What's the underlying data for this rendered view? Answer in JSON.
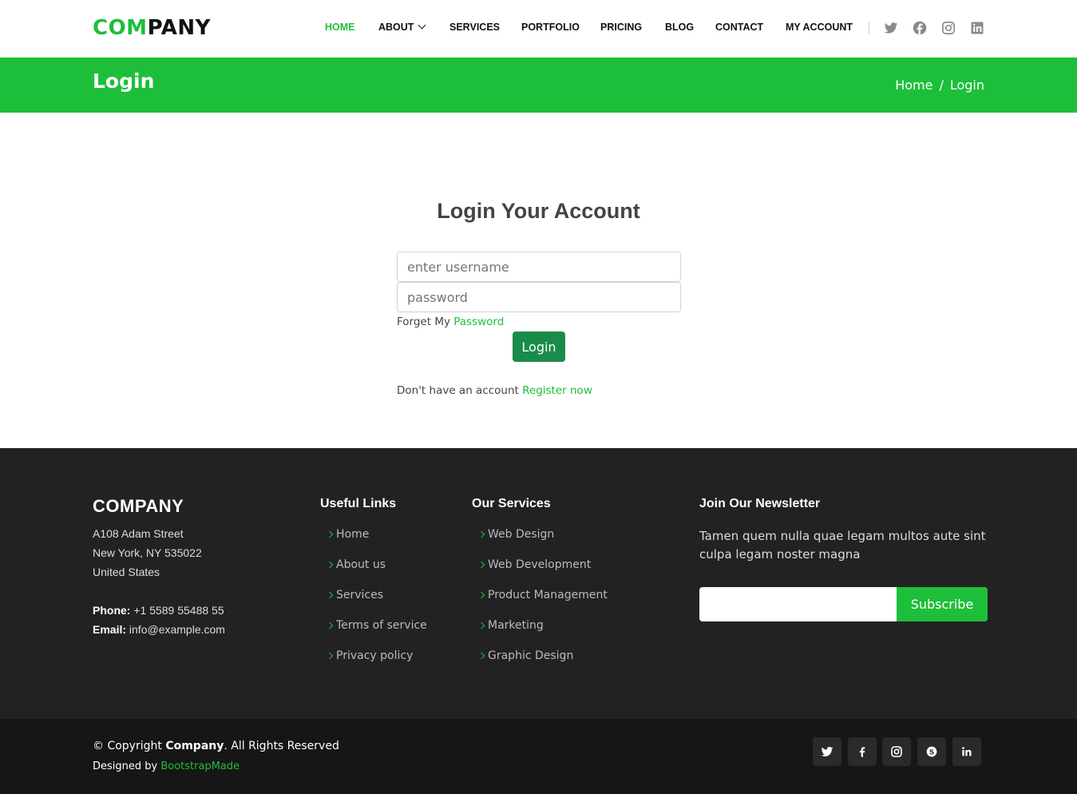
{
  "header": {
    "logo_accent": "COM",
    "logo_rest": "PANY",
    "nav": [
      "HOME",
      "ABOUT",
      "SERVICES",
      "PORTFOLIO",
      "PRICING",
      "BLOG",
      "CONTACT",
      "MY ACCOUNT"
    ],
    "active_nav": "HOME",
    "social_icons": [
      "twitter-icon",
      "facebook-icon",
      "instagram-icon",
      "linkedin-icon"
    ]
  },
  "titlebar": {
    "title": "Login",
    "breadcrumb_home": "Home",
    "breadcrumb_sep": "/",
    "breadcrumb_current": "Login"
  },
  "login": {
    "heading": "Login Your Account",
    "username_placeholder": "enter username",
    "password_placeholder": "password",
    "forget_text": "Forget My",
    "forget_link": "Password",
    "button": "Login",
    "register_text": "Don't have an account",
    "register_link": "Register now"
  },
  "footer": {
    "company": "COMPANY",
    "address": [
      "A108 Adam Street",
      "New York, NY 535022",
      "United States"
    ],
    "phone_label": "Phone:",
    "phone": "+1 5589 55488 55",
    "email_label": "Email:",
    "email": "info@example.com",
    "useful_links_heading": "Useful Links",
    "useful_links": [
      "Home",
      "About us",
      "Services",
      "Terms of service",
      "Privacy policy"
    ],
    "services_heading": "Our Services",
    "services": [
      "Web Design",
      "Web Development",
      "Product Management",
      "Marketing",
      "Graphic Design"
    ],
    "newsletter_heading": "Join Our Newsletter",
    "newsletter_text": "Tamen quem nulla quae legam multos aute sint culpa legam noster magna",
    "subscribe": "Subscribe"
  },
  "bottom": {
    "copyright_prefix": "© Copyright",
    "copyright_company": "Company",
    "copyright_suffix": ". All Rights Reserved",
    "designed_prefix": "Designed by",
    "designed_link": "BootstrapMade",
    "social_icons": [
      "twitter-icon",
      "facebook-icon",
      "instagram-icon",
      "skype-icon",
      "linkedin-icon"
    ]
  },
  "colors": {
    "accent": "#1dbf3a",
    "login_button": "#1b8b4b",
    "footer_bg": "#222222",
    "footer_bottom_bg": "#161616"
  }
}
